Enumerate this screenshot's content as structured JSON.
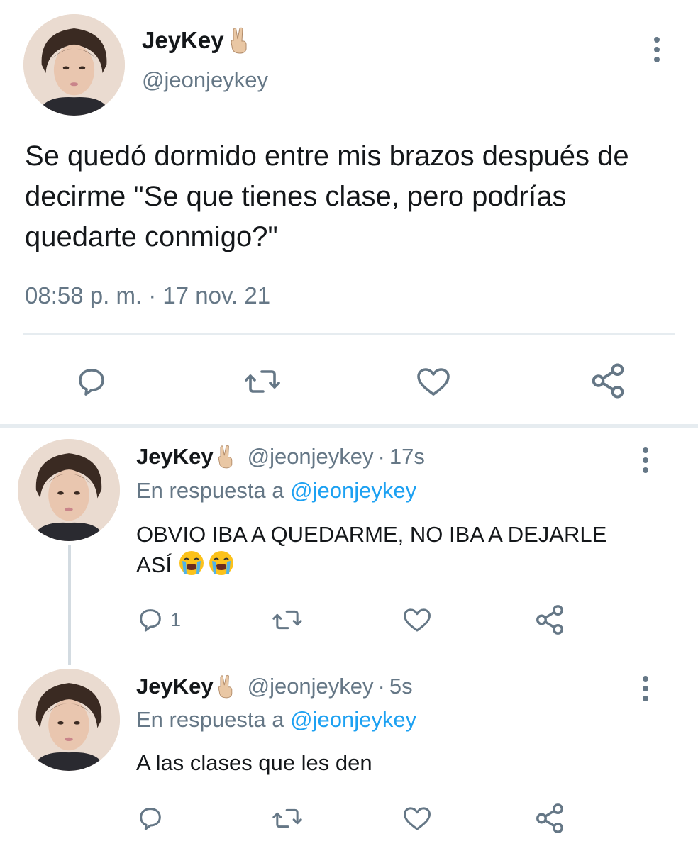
{
  "main_tweet": {
    "display_name": "JeyKey",
    "name_emoji": "victory-hand-emoji",
    "handle": "@jeonjeykey",
    "text": "Se quedó dormido entre mis brazos después de decirme \"Se que tienes clase, pero podrías quedarte conmigo?\"",
    "timestamp": "08:58 p. m. · 17 nov. 21",
    "icons": {
      "reply": "comment-icon",
      "retweet": "retweet-icon",
      "like": "heart-icon",
      "share": "share-icon",
      "menu": "more-vertical-icon"
    }
  },
  "replies": [
    {
      "display_name": "JeyKey",
      "handle": "@jeonjeykey",
      "separator": "·",
      "time": "17s",
      "reply_prefix": "En respuesta a",
      "reply_mention": "@jeonjeykey",
      "text": "OBVIO IBA A QUEDARME, NO IBA A DEJARLE ASÍ",
      "text_emojis": [
        "loudly-crying-face-emoji",
        "loudly-crying-face-emoji"
      ],
      "reply_count": "1"
    },
    {
      "display_name": "JeyKey",
      "handle": "@jeonjeykey",
      "separator": "·",
      "time": "5s",
      "reply_prefix": "En respuesta a",
      "reply_mention": "@jeonjeykey",
      "text": "A las clases que les den",
      "reply_count": ""
    }
  ],
  "colors": {
    "text": "#14171a",
    "secondary": "#657786",
    "link": "#1da1f2",
    "divider": "#e6ecf0",
    "icon": "#657786"
  }
}
